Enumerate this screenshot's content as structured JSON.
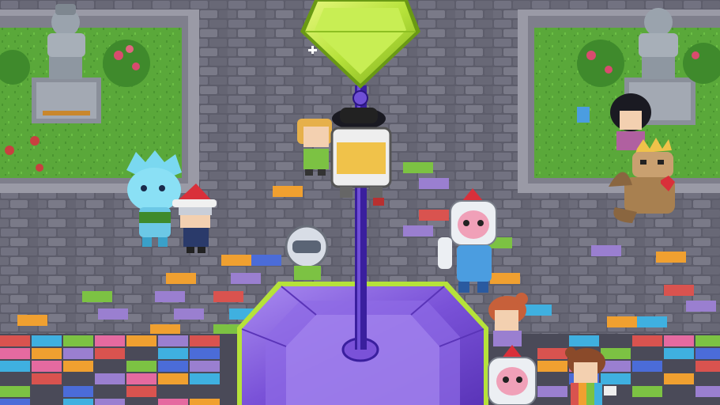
{
  "game": {
    "scene_name": "plaza",
    "colors": {
      "cobble_dark": "#5d5d6b",
      "cobble_light": "#7a7a88",
      "grass": "#5aa83a",
      "grass_dark": "#3f8a2c",
      "crystal_green": "#b6e23a",
      "crystal_purple": "#7a52d8",
      "pole": "#3a1f9e",
      "statue": "#9aa3ad"
    },
    "brick_palette": [
      "#d9534f",
      "#f0a030",
      "#3fb0e0",
      "#7cc243",
      "#9a7fd0",
      "#e56aa0",
      "#4b6cd8"
    ],
    "characters": [
      {
        "name": "blue-crystal-creature"
      },
      {
        "name": "santa-hat-kid"
      },
      {
        "name": "blonde-kid"
      },
      {
        "name": "pirate-hat-robot"
      },
      {
        "name": "astronaut-helmet-player"
      },
      {
        "name": "pink-rocket-suit-player"
      },
      {
        "name": "dark-hair-girl"
      },
      {
        "name": "crowned-dragon"
      },
      {
        "name": "red-hair-girl"
      },
      {
        "name": "second-rocket-suit-player"
      },
      {
        "name": "rainbow-shirt-girl"
      }
    ]
  }
}
